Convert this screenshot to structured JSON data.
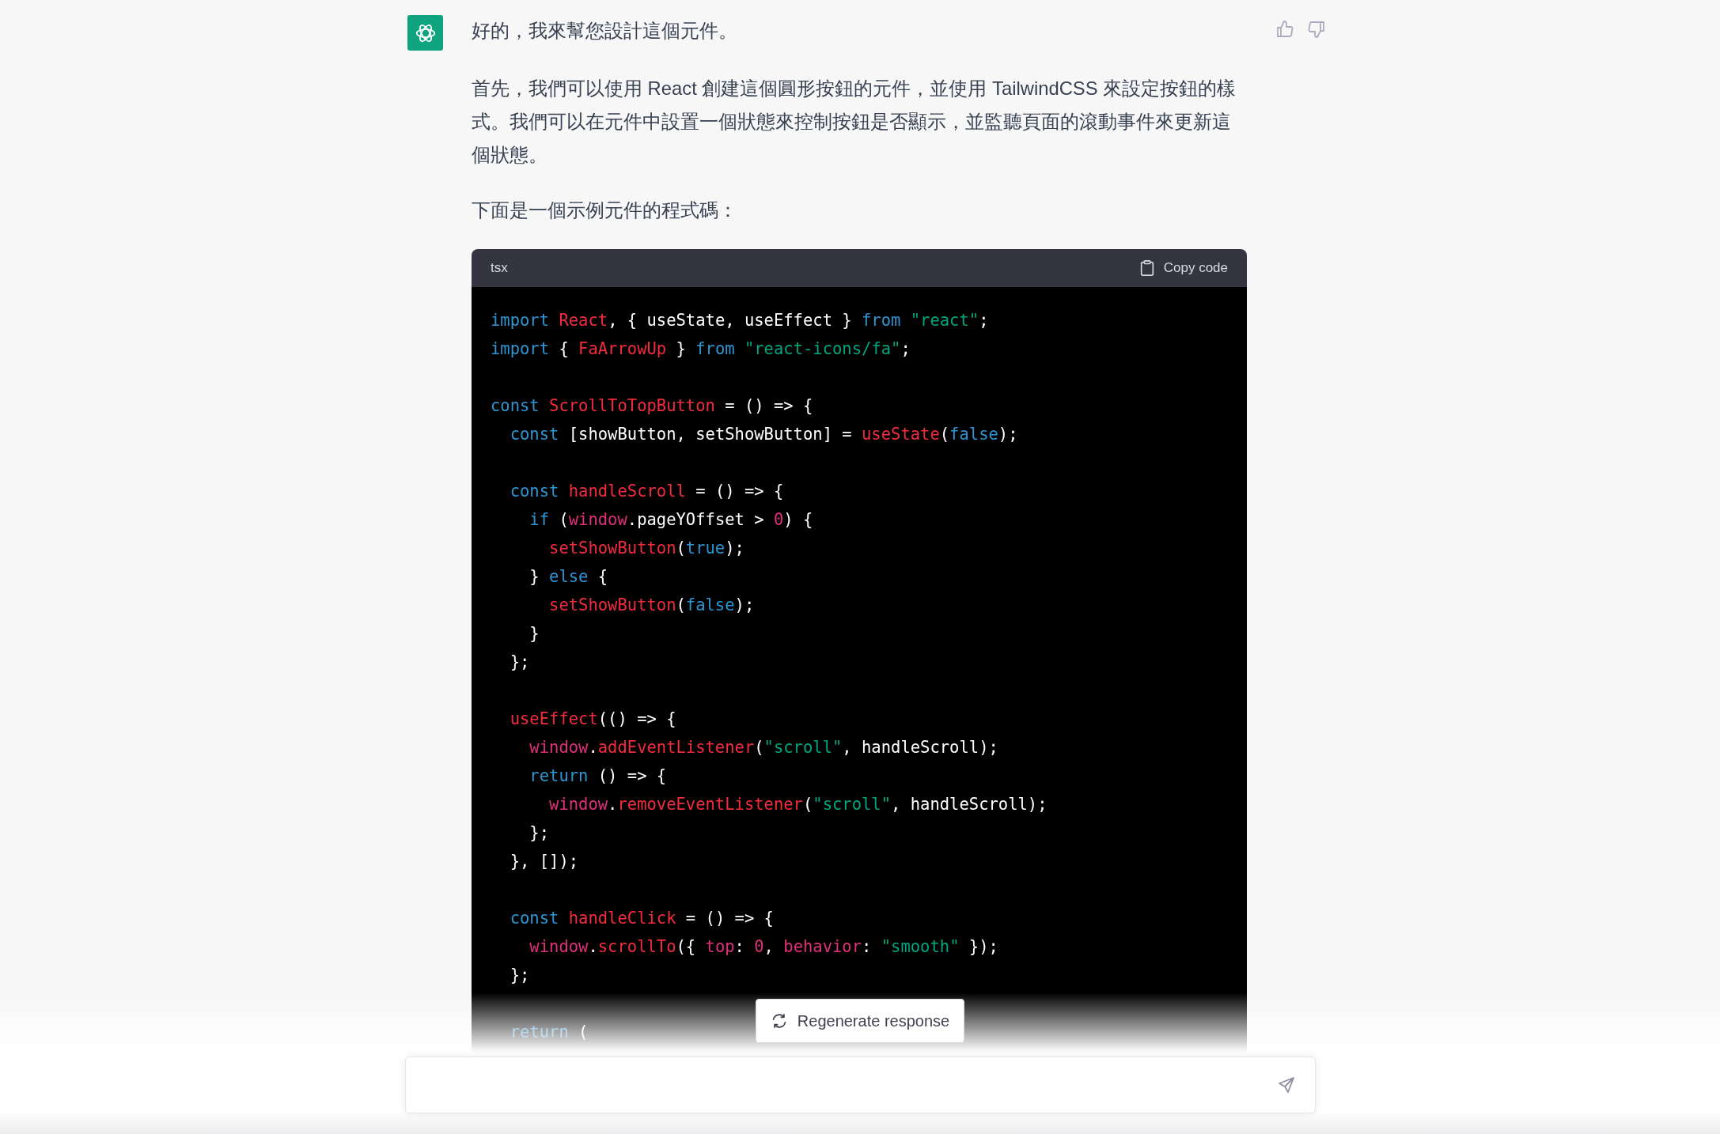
{
  "message": {
    "paragraphs": [
      "好的，我來幫您設計這個元件。",
      "首先，我們可以使用 React 創建這個圓形按鈕的元件，並使用 TailwindCSS 來設定按鈕的樣式。我們可以在元件中設置一個狀態來控制按鈕是否顯示，並監聽頁面的滾動事件來更新這個狀態。",
      "下面是一個示例元件的程式碼："
    ],
    "code": {
      "language": "tsx",
      "copy_label": "Copy code",
      "blocks": [
        [
          [
            {
              "kind": "kw",
              "text": "import"
            },
            {
              "kind": "fn",
              "text": " React"
            },
            {
              "kind": "plain",
              "text": ", { useState, useEffect } "
            },
            {
              "kind": "kw",
              "text": "from"
            },
            {
              "kind": "str",
              "text": " \"react\""
            },
            {
              "kind": "plain",
              "text": ";"
            }
          ],
          [
            {
              "kind": "kw",
              "text": "import"
            },
            {
              "kind": "plain",
              "text": " { "
            },
            {
              "kind": "fn",
              "text": "FaArrowUp"
            },
            {
              "kind": "plain",
              "text": " } "
            },
            {
              "kind": "kw",
              "text": "from"
            },
            {
              "kind": "str",
              "text": " \"react-icons/fa\""
            },
            {
              "kind": "plain",
              "text": ";"
            }
          ]
        ],
        [
          [
            {
              "kind": "kw",
              "text": "const"
            },
            {
              "kind": "fn",
              "text": " ScrollToTopButton"
            },
            {
              "kind": "plain",
              "text": " = () => {"
            }
          ],
          [
            {
              "kind": "kw",
              "text": "  const"
            },
            {
              "kind": "plain",
              "text": " [showButton, setShowButton] = "
            },
            {
              "kind": "fn",
              "text": "useState"
            },
            {
              "kind": "plain",
              "text": "("
            },
            {
              "kind": "kw",
              "text": "false"
            },
            {
              "kind": "plain",
              "text": ");"
            }
          ]
        ],
        [
          [
            {
              "kind": "kw",
              "text": "  const"
            },
            {
              "kind": "fn",
              "text": " handleScroll"
            },
            {
              "kind": "plain",
              "text": " = () => {"
            }
          ],
          [
            {
              "kind": "kw",
              "text": "    if"
            },
            {
              "kind": "plain",
              "text": " ("
            },
            {
              "kind": "var",
              "text": "window"
            },
            {
              "kind": "plain",
              "text": ".pageYOffset > "
            },
            {
              "kind": "var",
              "text": "0"
            },
            {
              "kind": "plain",
              "text": ") {"
            }
          ],
          [
            {
              "kind": "fn",
              "text": "      setShowButton"
            },
            {
              "kind": "plain",
              "text": "("
            },
            {
              "kind": "kw",
              "text": "true"
            },
            {
              "kind": "plain",
              "text": ");"
            }
          ],
          [
            {
              "kind": "plain",
              "text": "    } "
            },
            {
              "kind": "kw",
              "text": "else"
            },
            {
              "kind": "plain",
              "text": " {"
            }
          ],
          [
            {
              "kind": "fn",
              "text": "      setShowButton"
            },
            {
              "kind": "plain",
              "text": "("
            },
            {
              "kind": "kw",
              "text": "false"
            },
            {
              "kind": "plain",
              "text": ");"
            }
          ],
          [
            {
              "kind": "plain",
              "text": "    }"
            }
          ],
          [
            {
              "kind": "plain",
              "text": "  };"
            }
          ]
        ],
        [
          [
            {
              "kind": "fn",
              "text": "  useEffect"
            },
            {
              "kind": "plain",
              "text": "(() => {"
            }
          ],
          [
            {
              "kind": "var",
              "text": "    window"
            },
            {
              "kind": "plain",
              "text": "."
            },
            {
              "kind": "fn",
              "text": "addEventListener"
            },
            {
              "kind": "plain",
              "text": "("
            },
            {
              "kind": "str",
              "text": "\"scroll\""
            },
            {
              "kind": "plain",
              "text": ", handleScroll);"
            }
          ],
          [
            {
              "kind": "kw",
              "text": "    return"
            },
            {
              "kind": "plain",
              "text": " () => {"
            }
          ],
          [
            {
              "kind": "var",
              "text": "      window"
            },
            {
              "kind": "plain",
              "text": "."
            },
            {
              "kind": "fn",
              "text": "removeEventListener"
            },
            {
              "kind": "plain",
              "text": "("
            },
            {
              "kind": "str",
              "text": "\"scroll\""
            },
            {
              "kind": "plain",
              "text": ", handleScroll);"
            }
          ],
          [
            {
              "kind": "plain",
              "text": "    };"
            }
          ],
          [
            {
              "kind": "plain",
              "text": "  }, []);"
            }
          ]
        ],
        [
          [
            {
              "kind": "kw",
              "text": "  const"
            },
            {
              "kind": "fn",
              "text": " handleClick"
            },
            {
              "kind": "plain",
              "text": " = () => {"
            }
          ],
          [
            {
              "kind": "var",
              "text": "    window"
            },
            {
              "kind": "plain",
              "text": "."
            },
            {
              "kind": "fn",
              "text": "scrollTo"
            },
            {
              "kind": "plain",
              "text": "({ "
            },
            {
              "kind": "var",
              "text": "top"
            },
            {
              "kind": "plain",
              "text": ": "
            },
            {
              "kind": "var",
              "text": "0"
            },
            {
              "kind": "plain",
              "text": ", "
            },
            {
              "kind": "var",
              "text": "behavior"
            },
            {
              "kind": "plain",
              "text": ": "
            },
            {
              "kind": "str",
              "text": "\"smooth\""
            },
            {
              "kind": "plain",
              "text": " });"
            }
          ],
          [
            {
              "kind": "plain",
              "text": "  };"
            }
          ]
        ],
        [
          [
            {
              "kind": "kw",
              "text": "  return"
            },
            {
              "kind": "plain",
              "text": " ("
            }
          ]
        ]
      ]
    }
  },
  "regenerate_label": "Regenerate response"
}
